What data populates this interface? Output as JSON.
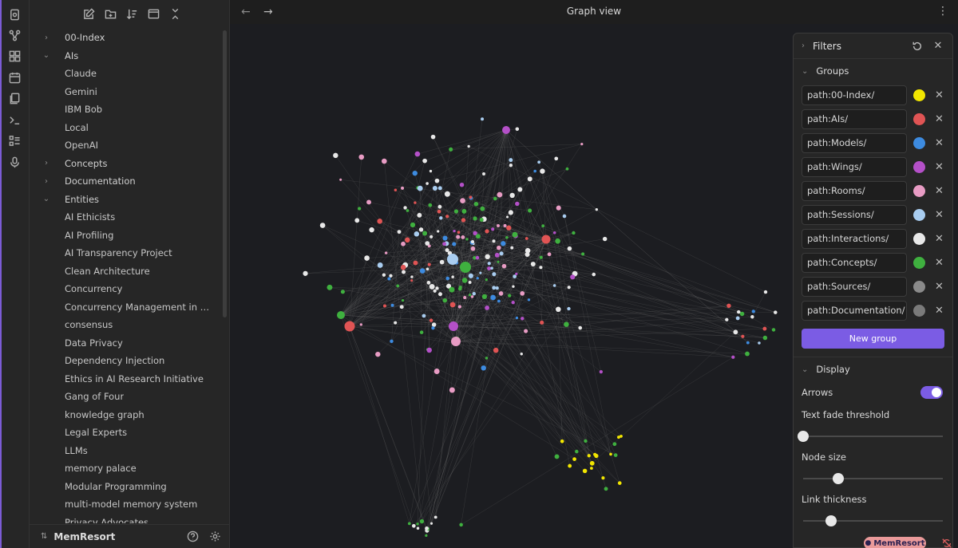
{
  "ribbon": {
    "icons": [
      "quick-switcher-icon",
      "graph-icon",
      "canvas-icon",
      "calendar-icon",
      "files-icon",
      "terminal-icon",
      "list-icon",
      "microphone-icon"
    ]
  },
  "sidebar": {
    "toolbar_icons": [
      "new-note-icon",
      "new-folder-icon",
      "sort-icon",
      "collapse-view-icon",
      "collapse-all-icon"
    ],
    "tree": [
      {
        "label": "00-Index",
        "type": "folder",
        "open": false
      },
      {
        "label": "AIs",
        "type": "folder",
        "open": true
      },
      {
        "label": "Claude",
        "type": "child"
      },
      {
        "label": "Gemini",
        "type": "child"
      },
      {
        "label": "IBM Bob",
        "type": "child"
      },
      {
        "label": "Local",
        "type": "child"
      },
      {
        "label": "OpenAI",
        "type": "child"
      },
      {
        "label": "Concepts",
        "type": "folder",
        "open": false
      },
      {
        "label": "Documentation",
        "type": "folder",
        "open": false
      },
      {
        "label": "Entities",
        "type": "folder",
        "open": true
      },
      {
        "label": "AI Ethicists",
        "type": "child"
      },
      {
        "label": "AI Profiling",
        "type": "child"
      },
      {
        "label": "AI Transparency Project",
        "type": "child"
      },
      {
        "label": "Clean Architecture",
        "type": "child"
      },
      {
        "label": "Concurrency",
        "type": "child"
      },
      {
        "label": "Concurrency Management in Data...",
        "type": "child"
      },
      {
        "label": "consensus",
        "type": "child"
      },
      {
        "label": "Data Privacy",
        "type": "child"
      },
      {
        "label": "Dependency Injection",
        "type": "child"
      },
      {
        "label": "Ethics in AI Research Initiative",
        "type": "child"
      },
      {
        "label": "Gang of Four",
        "type": "child"
      },
      {
        "label": "knowledge graph",
        "type": "child"
      },
      {
        "label": "Legal Experts",
        "type": "child"
      },
      {
        "label": "LLMs",
        "type": "child"
      },
      {
        "label": "memory palace",
        "type": "child"
      },
      {
        "label": "Modular Programming",
        "type": "child"
      },
      {
        "label": "multi-model memory system",
        "type": "child"
      },
      {
        "label": "Privacy Advocates",
        "type": "child"
      }
    ],
    "vault_name": "MemResort"
  },
  "main": {
    "title": "Graph view",
    "back_icon": "←",
    "forward_icon": "→",
    "more_icon": "⋮"
  },
  "filters": {
    "title": "Filters",
    "groups_title": "Groups",
    "groups": [
      {
        "query": "path:00-Index/",
        "color": "#f2e600"
      },
      {
        "query": "path:AIs/",
        "color": "#e05454"
      },
      {
        "query": "path:Models/",
        "color": "#3d8be0"
      },
      {
        "query": "path:Wings/",
        "color": "#b450c8"
      },
      {
        "query": "path:Rooms/",
        "color": "#e89cc4"
      },
      {
        "query": "path:Sessions/",
        "color": "#a9cdf0"
      },
      {
        "query": "path:Interactions/",
        "color": "#e8e8e8"
      },
      {
        "query": "path:Concepts/",
        "color": "#3fb03f"
      },
      {
        "query": "path:Sources/",
        "color": "#8a8a8a"
      },
      {
        "query": "path:Documentation/",
        "color": "#7a7a7a"
      }
    ],
    "new_group_label": "New group",
    "display_title": "Display",
    "arrows_label": "Arrows",
    "arrows_on": true,
    "text_fade_label": "Text fade threshold",
    "text_fade_value": 0.0,
    "node_size_label": "Node size",
    "node_size_value": 0.25,
    "link_thickness_label": "Link thickness",
    "link_thickness_value": 0.2
  },
  "status": {
    "badge": "MemResort"
  }
}
